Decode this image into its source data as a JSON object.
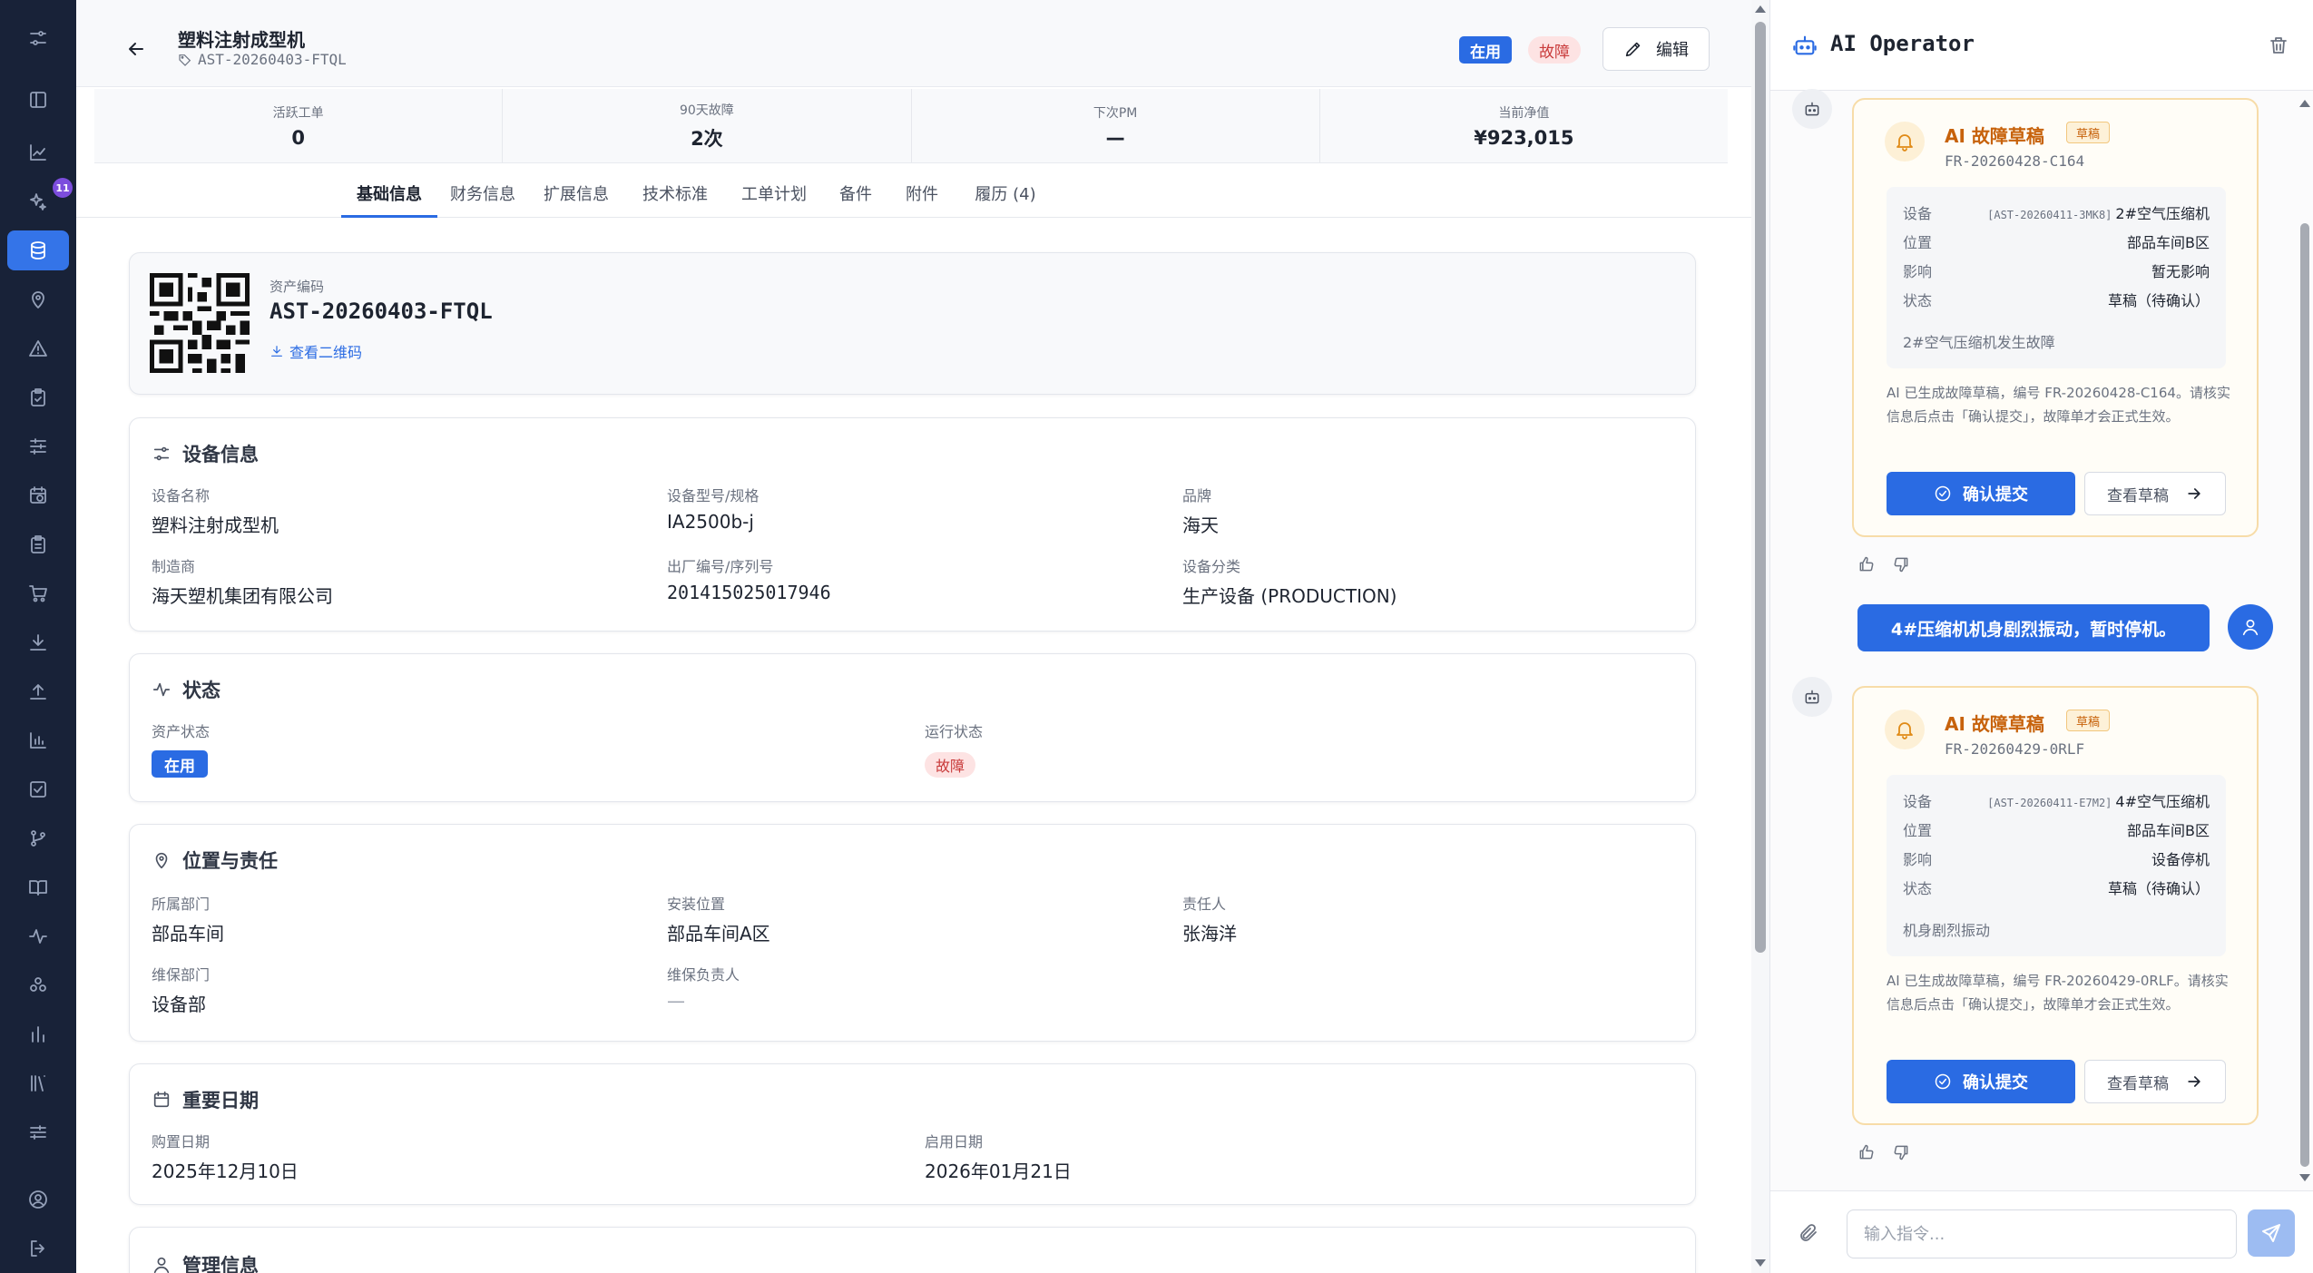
{
  "nav": {
    "badge_count": "11",
    "items": [
      "filters-icon",
      "sidebar-toggle-icon",
      "line-chart-icon",
      "sparkles-icon",
      "database-icon",
      "location-pin-icon",
      "alert-triangle-icon",
      "clipboard-check-icon",
      "sliders-icon",
      "calendar-clock-icon",
      "clipboard-list-icon",
      "cart-icon",
      "download-icon",
      "upload-icon",
      "bar-chart-icon",
      "checkbox-icon",
      "git-branch-icon",
      "book-open-icon",
      "activity-icon",
      "boxes-icon",
      "bar-chart-2-icon",
      "library-icon",
      "settings-sliders-icon",
      "user-circle-icon",
      "logout-icon"
    ]
  },
  "header": {
    "title": "塑料注射成型机",
    "asset_code": "AST-20260403-FTQL",
    "badge_inuse": "在用",
    "badge_fault": "故障",
    "edit_label": "编辑"
  },
  "stats": [
    {
      "label": "活跃工单",
      "value": "0"
    },
    {
      "label": "90天故障",
      "value": "2次"
    },
    {
      "label": "下次PM",
      "value": "—"
    },
    {
      "label": "当前净值",
      "value": "¥923,015"
    }
  ],
  "tabs": [
    "基础信息",
    "财务信息",
    "扩展信息",
    "技术标准",
    "工单计划",
    "备件",
    "附件",
    "履历 (4)"
  ],
  "qr_card": {
    "label": "资产编码",
    "code": "AST-20260403-FTQL",
    "link": "查看二维码"
  },
  "equipment": {
    "title": "设备信息",
    "fields": [
      {
        "label": "设备名称",
        "value": "塑料注射成型机"
      },
      {
        "label": "设备型号/规格",
        "value": "IA2500b-j"
      },
      {
        "label": "品牌",
        "value": "海天"
      },
      {
        "label": "制造商",
        "value": "海天塑机集团有限公司"
      },
      {
        "label": "出厂编号/序列号",
        "value": "201415025017946"
      },
      {
        "label": "设备分类",
        "value": "生产设备 (PRODUCTION)"
      }
    ]
  },
  "status": {
    "title": "状态",
    "asset_status_label": "资产状态",
    "asset_status_value": "在用",
    "run_status_label": "运行状态",
    "run_status_value": "故障"
  },
  "location": {
    "title": "位置与责任",
    "fields": [
      {
        "label": "所属部门",
        "value": "部品车间"
      },
      {
        "label": "安装位置",
        "value": "部品车间A区"
      },
      {
        "label": "责任人",
        "value": "张海洋"
      },
      {
        "label": "维保部门",
        "value": "设备部"
      },
      {
        "label": "维保负责人",
        "value": "—"
      }
    ]
  },
  "dates": {
    "title": "重要日期",
    "fields": [
      {
        "label": "购置日期",
        "value": "2025年12月10日"
      },
      {
        "label": "启用日期",
        "value": "2026年01月21日"
      }
    ]
  },
  "management": {
    "title": "管理信息"
  },
  "ai": {
    "title": "AI Operator",
    "drafts": [
      {
        "title": "AI 故障草稿",
        "tag": "草稿",
        "number": "FR-20260428-C164",
        "rows": [
          {
            "label": "设备",
            "code": "[AST-20260411-3MK8]",
            "value": "2#空气压缩机"
          },
          {
            "label": "位置",
            "value": "部品车间B区"
          },
          {
            "label": "影响",
            "value": "暂无影响"
          },
          {
            "label": "状态",
            "value": "草稿（待确认）"
          }
        ],
        "desc": "2#空气压缩机发生故障",
        "note": "AI 已生成故障草稿，编号 FR-20260428-C164。请核实信息后点击「确认提交」，故障单才会正式生效。",
        "confirm": "确认提交",
        "view": "查看草稿"
      },
      {
        "title": "AI 故障草稿",
        "tag": "草稿",
        "number": "FR-20260429-0RLF",
        "rows": [
          {
            "label": "设备",
            "code": "[AST-20260411-E7M2]",
            "value": "4#空气压缩机"
          },
          {
            "label": "位置",
            "value": "部品车间B区"
          },
          {
            "label": "影响",
            "value": "设备停机"
          },
          {
            "label": "状态",
            "value": "草稿（待确认）"
          }
        ],
        "desc": "机身剧烈振动",
        "note": "AI 已生成故障草稿，编号 FR-20260429-0RLF。请核实信息后点击「确认提交」，故障单才会正式生效。",
        "confirm": "确认提交",
        "view": "查看草稿"
      }
    ],
    "user_message": "4#压缩机机身剧烈振动，暂时停机。",
    "input_placeholder": "输入指令..."
  }
}
